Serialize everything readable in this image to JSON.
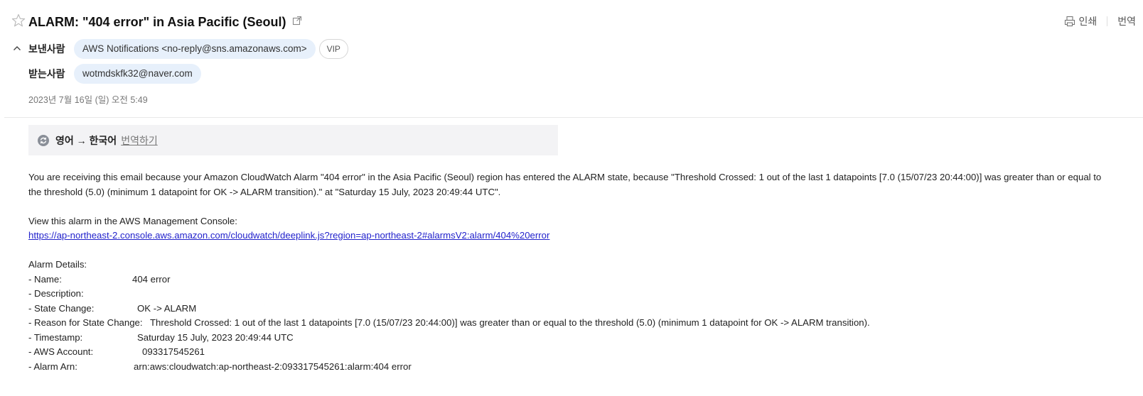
{
  "header": {
    "subject": "ALARM: \"404 error\" in Asia Pacific (Seoul)",
    "print_label": "인쇄",
    "translate_label": "번역"
  },
  "sender": {
    "label": "보낸사람",
    "name": "AWS Notifications <no-reply@sns.amazonaws.com>",
    "vip_label": "VIP"
  },
  "recipient": {
    "label": "받는사람",
    "address": "wotmdskfk32@naver.com"
  },
  "date": "2023년 7월 16일 (일) 오전 5:49",
  "translate_bar": {
    "languages": "영어 → 한국어",
    "action": "번역하기"
  },
  "body": {
    "intro": "You are receiving this email because your Amazon CloudWatch Alarm \"404 error\" in the Asia Pacific (Seoul) region has entered the ALARM state, because \"Threshold Crossed: 1 out of the last 1 datapoints [7.0 (15/07/23 20:44:00)] was greater than or equal to the threshold (5.0) (minimum 1 datapoint for OK -> ALARM transition).\" at \"Saturday 15 July, 2023 20:49:44 UTC\".",
    "console_label": "View this alarm in the AWS Management Console:",
    "console_link": "https://ap-northeast-2.console.aws.amazon.com/cloudwatch/deeplink.js?region=ap-northeast-2#alarmsV2:alarm/404%20error",
    "details_title": "Alarm Details:",
    "details": [
      {
        "key": "- Name:",
        "value": "404 error"
      },
      {
        "key": "- Description:",
        "value": ""
      },
      {
        "key": "- State Change:",
        "value": "OK -> ALARM"
      },
      {
        "key": "- Reason for State Change:",
        "value": "Threshold Crossed: 1 out of the last 1 datapoints [7.0 (15/07/23 20:44:00)] was greater than or equal to the threshold (5.0) (minimum 1 datapoint for OK -> ALARM transition)."
      },
      {
        "key": "- Timestamp:",
        "value": "Saturday 15 July, 2023 20:49:44 UTC"
      },
      {
        "key": "- AWS Account:",
        "value": "093317545261"
      },
      {
        "key": "- Alarm Arn:",
        "value": "arn:aws:cloudwatch:ap-northeast-2:093317545261:alarm:404 error"
      }
    ]
  },
  "colors": {
    "pill_bg": "#e7f0fb",
    "link": "#2222cc",
    "translate_bg": "#f3f3f5"
  }
}
